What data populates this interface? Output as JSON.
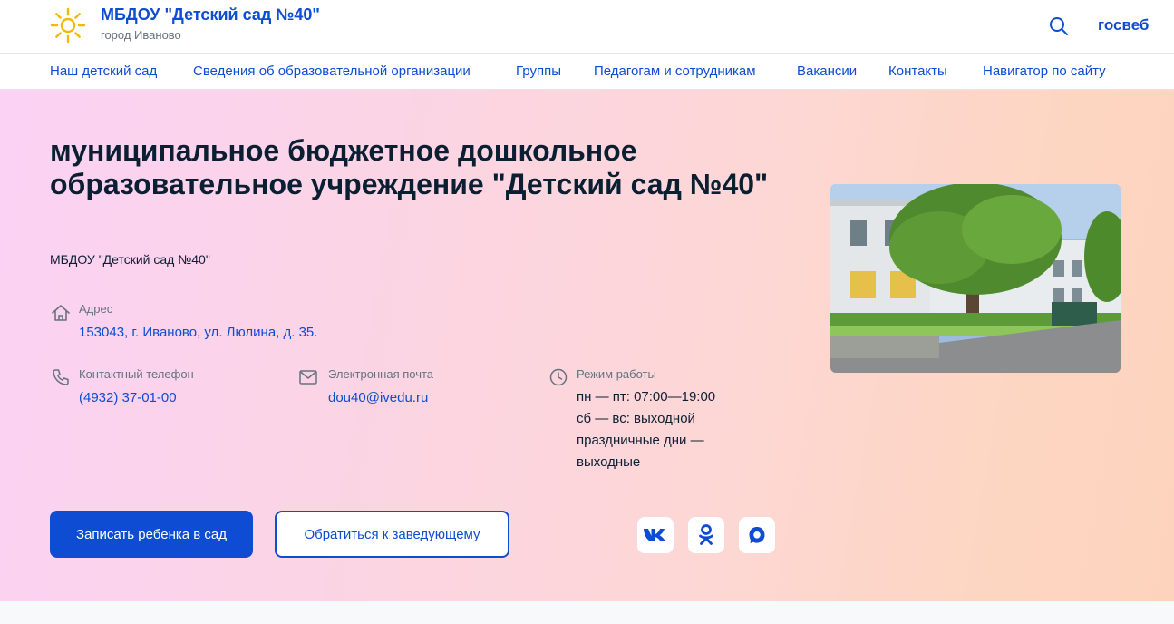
{
  "header": {
    "org_name": "МБДОУ \"Детский сад №40\"",
    "org_city": "город Иваново",
    "gosweb_label": "госвеб",
    "logo_icon": "sun-icon",
    "search_icon": "search-icon"
  },
  "nav": {
    "items": [
      "Наш детский сад",
      "Сведения об образовательной организации",
      "Группы",
      "Педагогам и сотрудникам",
      "Вакансии",
      "Контакты",
      "Навигатор по сайту"
    ]
  },
  "hero": {
    "title": "муниципальное бюджетное дошкольное образовательное учреждение \"Детский сад №40\"",
    "subtitle": "МБДОУ \"Детский сад №40\"",
    "address": {
      "label": "Адрес",
      "value": "153043, г. Иваново, ул. Люлина, д. 35.",
      "icon": "house-icon"
    },
    "phone": {
      "label": "Контактный телефон",
      "value": "(4932) 37-01-00",
      "icon": "phone-icon"
    },
    "email": {
      "label": "Электронная почта",
      "value": "dou40@ivedu.ru",
      "icon": "mail-icon"
    },
    "hours": {
      "label": "Режим работы",
      "icon": "clock-icon",
      "lines": [
        "пн — пт: 07:00—19:00",
        "сб — вс: выходной",
        "праздничные дни —",
        "выходные"
      ]
    },
    "buttons": {
      "enroll": "Записать ребенка в сад",
      "contact_head": "Обратиться к заведующему"
    },
    "social": [
      "vk-icon",
      "odnoklassniki-icon",
      "max-messenger-icon"
    ]
  },
  "colors": {
    "accent": "#0d4cd3",
    "text": "#0b1f33",
    "muted": "#66727f",
    "logo": "#f5b800"
  }
}
